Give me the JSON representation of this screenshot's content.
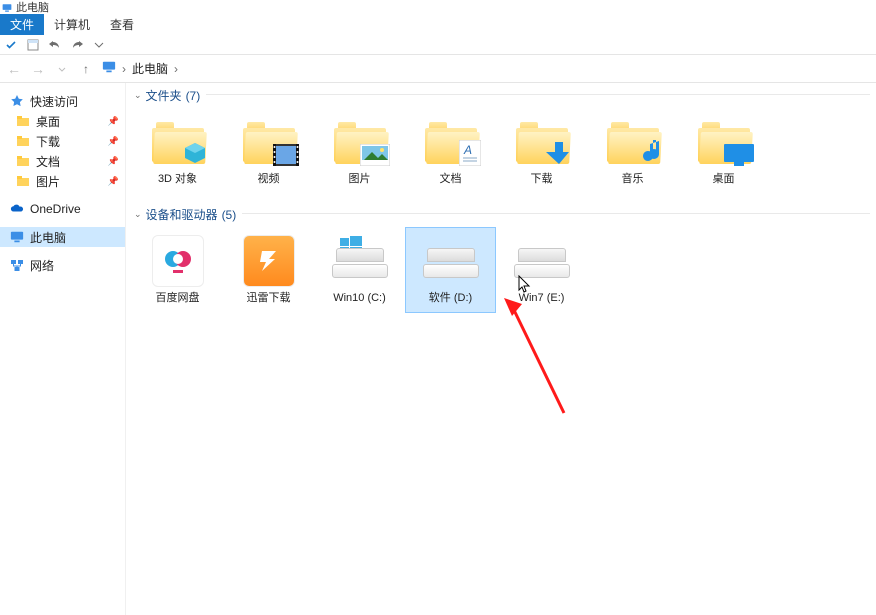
{
  "window": {
    "title": "此电脑"
  },
  "ribbon": {
    "tabs": {
      "file": "文件",
      "computer": "计算机",
      "view": "查看"
    }
  },
  "breadcrumb": {
    "location": "此电脑"
  },
  "sidebar": {
    "quick": {
      "label": "快速访问",
      "items": [
        "桌面",
        "下载",
        "文档",
        "图片"
      ]
    },
    "onedrive": "OneDrive",
    "thispc": "此电脑",
    "network": "网络"
  },
  "sections": {
    "folders": {
      "title": "文件夹",
      "count": "(7)",
      "items": [
        "3D 对象",
        "视频",
        "图片",
        "文档",
        "下载",
        "音乐",
        "桌面"
      ]
    },
    "devices": {
      "title": "设备和驱动器",
      "count": "(5)",
      "items": [
        "百度网盘",
        "迅雷下载",
        "Win10 (C:)",
        "软件 (D:)",
        "Win7 (E:)"
      ],
      "selected_index": 3
    }
  }
}
